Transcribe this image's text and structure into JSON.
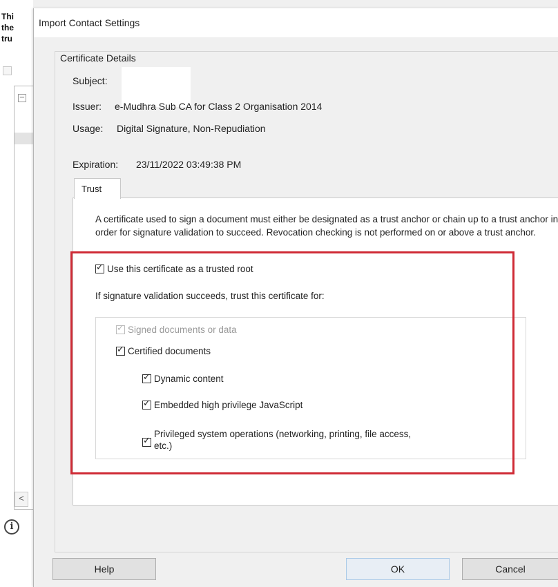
{
  "background_window": {
    "lines": [
      "Thi",
      "the",
      "tru"
    ],
    "scroll_left": "<",
    "info_icon": "i"
  },
  "dialog": {
    "title": "Import Contact Settings",
    "group_label": "Certificate Details",
    "subject_label": "Subject:",
    "subject_value": "",
    "issuer_label": "Issuer:",
    "issuer_value": "e-Mudhra Sub CA for Class 2 Organisation 2014",
    "usage_label": "Usage:",
    "usage_value": "Digital Signature, Non-Repudiation",
    "expiration_label": "Expiration:",
    "expiration_value": "23/11/2022 03:49:38 PM",
    "tab_label": "Trust",
    "paragraph": "A certificate used to sign a document must either be designated as a trust anchor or chain up to a trust anchor in order for signature validation to succeed.  Revocation checking is not performed on or above a trust anchor.",
    "trusted_root_label": "Use this certificate as a trusted root",
    "trusted_root_checked": true,
    "trust_for_label": "If signature validation succeeds, trust this certificate for:",
    "options": {
      "signed_documents": {
        "label": "Signed documents or data",
        "checked": true,
        "disabled": true
      },
      "certified_documents": {
        "label": "Certified documents",
        "checked": true
      },
      "dynamic_content": {
        "label": "Dynamic content",
        "checked": true
      },
      "embedded_js": {
        "label": "Embedded high privilege JavaScript",
        "checked": true
      },
      "privileged_ops": {
        "label_line1": "Privileged system operations (networking, printing, file access,",
        "label_line2": "etc.)",
        "checked": true
      }
    },
    "buttons": {
      "help": "Help",
      "ok": "OK",
      "cancel": "Cancel"
    },
    "check_glyph": "✓",
    "highlight_color": "#cf2a35"
  }
}
